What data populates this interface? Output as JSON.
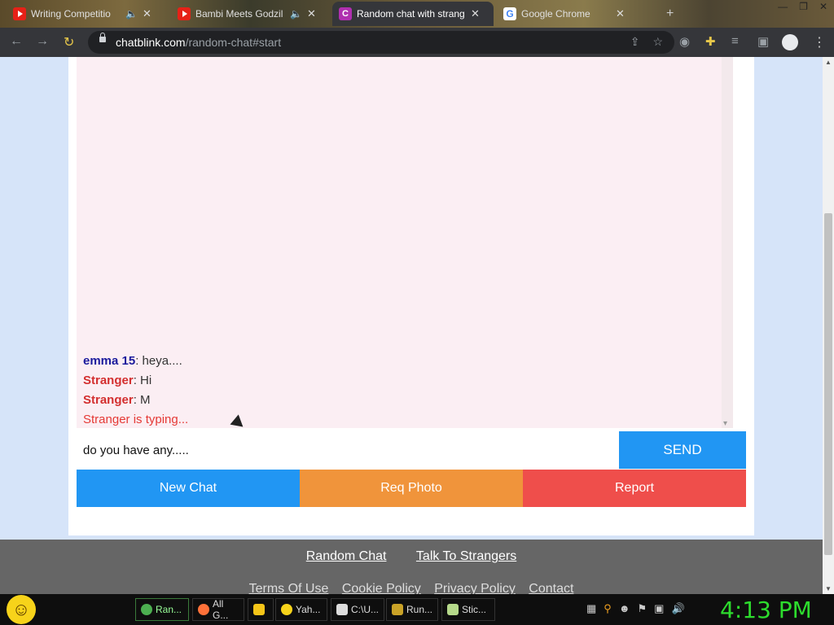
{
  "browser": {
    "tabs": [
      {
        "title": "Writing Competitio",
        "icon": "youtube-icon"
      },
      {
        "title": "Bambi Meets Godzil",
        "icon": "youtube-icon"
      },
      {
        "title": "Random chat with strang",
        "icon": "chatblink-icon",
        "active": true
      },
      {
        "title": "Google Chrome",
        "icon": "google-icon"
      }
    ],
    "url_host": "chatblink.com",
    "url_path": "/random-chat#start"
  },
  "chat": {
    "messages": [
      {
        "sender": "emma 15",
        "text": ": heya....",
        "role": "me"
      },
      {
        "sender": "Stranger",
        "text": ": Hi",
        "role": "stranger"
      },
      {
        "sender": "Stranger",
        "text": ": M",
        "role": "stranger"
      }
    ],
    "typing": "Stranger is typing...",
    "input_value": "do you have any.....",
    "send_label": "SEND"
  },
  "actions": {
    "new_chat": "New Chat",
    "req_photo": "Req Photo",
    "report": "Report"
  },
  "footer": {
    "links_primary": [
      "Random Chat",
      "Talk To Strangers"
    ],
    "links_secondary": [
      "Terms Of Use",
      "Cookie Policy",
      "Privacy Policy",
      "Contact"
    ]
  },
  "taskbar": {
    "items": [
      "Ran...",
      "All G...",
      "",
      "Yah...",
      "C:\\U...",
      "Run...",
      "Stic..."
    ],
    "clock": "4:13 PM"
  },
  "colors": {
    "send": "#2196f3",
    "req_photo": "#f0943b",
    "report": "#ef4e4b",
    "chat_bg": "#fbeef3",
    "clock": "#2ddc2d"
  }
}
